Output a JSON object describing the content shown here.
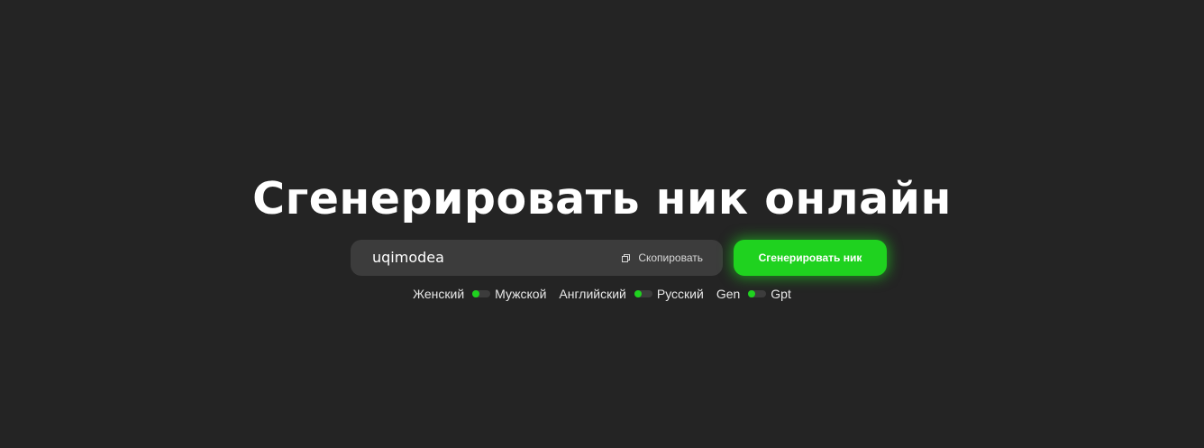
{
  "page": {
    "title": "Сгенерировать ник онлайн"
  },
  "generator": {
    "result_value": "uqimodea",
    "copy_label": "Скопировать",
    "generate_label": "Сгенерировать ник"
  },
  "toggles": [
    {
      "left_label": "Женский",
      "right_label": "Мужской",
      "knob_side": "left"
    },
    {
      "left_label": "Английский",
      "right_label": "Русский",
      "knob_side": "left"
    },
    {
      "left_label": "Gen",
      "right_label": "Gpt",
      "knob_side": "left"
    }
  ],
  "colors": {
    "background": "#242424",
    "accent": "#1fd21f",
    "field": "#3c3c3c"
  },
  "icons": {
    "copy": "copy-icon"
  }
}
